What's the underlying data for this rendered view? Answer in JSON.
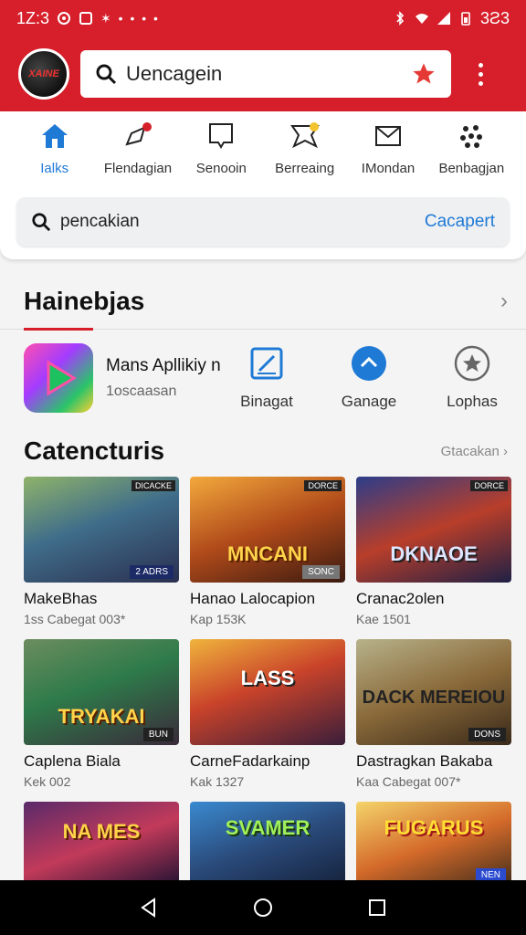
{
  "status": {
    "time": "1Z:3",
    "battery": "3Ƨ3"
  },
  "header": {
    "search_query": "Uencagein",
    "avatar_text": "XAINE"
  },
  "tabs": [
    {
      "label": "Ialks"
    },
    {
      "label": "Flendagian"
    },
    {
      "label": "Senooin"
    },
    {
      "label": "Berreaing"
    },
    {
      "label": "IMondan"
    },
    {
      "label": "Benbagjan"
    }
  ],
  "search": {
    "query": "pencakian",
    "action": "Cacapert"
  },
  "section": {
    "title": "Hainebjas"
  },
  "featured": {
    "name": "Mans Apllikiy n",
    "sub": "1oscaasan",
    "actions": [
      {
        "label": "Binagat"
      },
      {
        "label": "Ganage"
      },
      {
        "label": "Lophas"
      }
    ]
  },
  "categories": {
    "title": "Catencturis",
    "link": "Gtacakan",
    "rows": [
      [
        {
          "title": "MakeBhas",
          "sub": "1ss Cabegat 003*",
          "tag": "DICACKE",
          "tag2": "2 ADRS",
          "big": ""
        },
        {
          "title": "Hanao Lalocapion",
          "sub": "Kap 153K",
          "tag": "DORCE",
          "tag2": "SONC",
          "big": "MNCANI"
        },
        {
          "title": "Cranac2olen",
          "sub": "Kae 1501",
          "tag": "DORCE",
          "tag2": "",
          "big": "DKNAOE"
        }
      ],
      [
        {
          "title": "Caplena Biala",
          "sub": "Kek 002",
          "tag": "",
          "tag2": "BUN",
          "big": "TRYAKAI"
        },
        {
          "title": "CarneFadarkainp",
          "sub": "Kak 1327",
          "tag": "",
          "tag2": "",
          "big": "LASS"
        },
        {
          "title": "Dastragkan Bakaba",
          "sub": "Kaa Cabegat 007*",
          "tag": "",
          "tag2": "DONS",
          "big": "DACK MEREIOU"
        }
      ],
      [
        {
          "title": "",
          "sub": "",
          "tag": "",
          "tag2": "",
          "big": "NA MES"
        },
        {
          "title": "",
          "sub": "",
          "tag": "",
          "tag2": "",
          "big": "SVAMER"
        },
        {
          "title": "",
          "sub": "",
          "tag": "",
          "tag2": "NEN",
          "big": "FUGARUS"
        }
      ]
    ]
  },
  "colors": {
    "brand": "#d61f2a",
    "accent": "#1f7ad6"
  }
}
